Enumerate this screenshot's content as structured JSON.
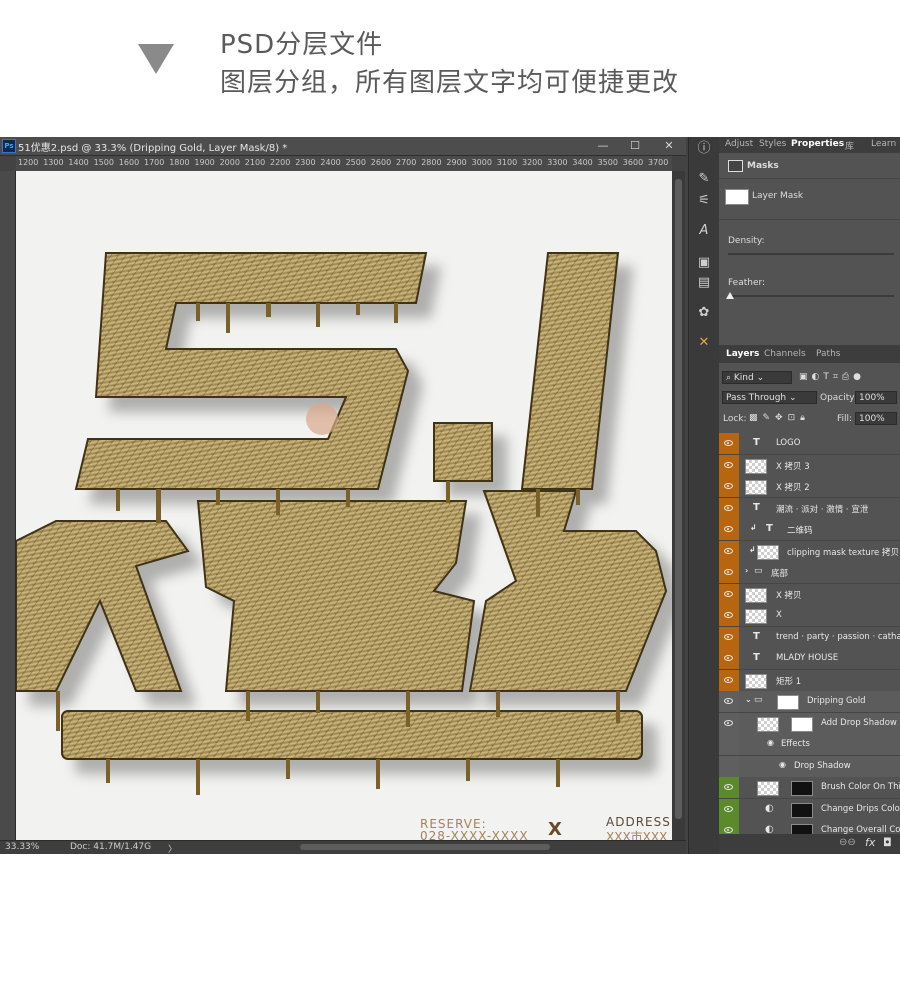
{
  "header": {
    "line1": "PSD分层文件",
    "line2": "图层分组，所有图层文字均可便捷更改"
  },
  "document": {
    "title": "51优惠2.psd @ 33.3% (Dripping Gold, Layer Mask/8) *",
    "ps_badge": "Ps",
    "window_controls": [
      "—",
      "☐",
      "✕"
    ],
    "ruler_marks": [
      "1200",
      "1300",
      "1400",
      "1500",
      "1600",
      "1700",
      "1800",
      "1900",
      "2000",
      "2100",
      "2200",
      "2300",
      "2400",
      "2500",
      "2600",
      "2700",
      "2800",
      "2900",
      "3000",
      "3100",
      "3200",
      "3300",
      "3400",
      "3500",
      "3600",
      "3700"
    ],
    "canvas": {
      "reserve_label": "RESERVE:",
      "reserve_value": "028-XXXX-XXXX",
      "x_mark": "X",
      "address_label": "ADDRESS",
      "address_value": "XXX市XXX"
    },
    "status": {
      "zoom": "33.33%",
      "doc": "Doc: 41.7M/1.47G",
      "arrow": "〉"
    }
  },
  "panel": {
    "top_tabs": [
      "Adjust",
      "Styles",
      "Properties",
      "库",
      "Learn"
    ],
    "masks_title": "Masks",
    "layer_mask_label": "Layer Mask",
    "density_label": "Density:",
    "feather_label": "Feather:",
    "layer_tabs": [
      "Layers",
      "Channels",
      "Paths"
    ],
    "kind_label": "Kind",
    "blend_mode": "Pass Through",
    "opacity_label": "Opacity:",
    "opacity_value": "100%",
    "lock_label": "Lock:",
    "fill_label": "Fill:",
    "fill_value": "100%"
  },
  "layers": [
    {
      "name": "LOGO",
      "kind": "text",
      "color": "#b8650f"
    },
    {
      "name": "X 拷贝 3",
      "kind": "pixel",
      "color": "#b8650f"
    },
    {
      "name": "X 拷贝 2",
      "kind": "pixel",
      "color": "#b8650f"
    },
    {
      "name": "潮流 · 派对 · 激情 · 宣泄",
      "kind": "text",
      "color": "#b8650f"
    },
    {
      "name": "二维码",
      "kind": "text-clip",
      "color": "#b8650f"
    },
    {
      "name": "clipping mask texture 拷贝",
      "kind": "pixel-clip",
      "color": "#b8650f"
    },
    {
      "name": "底部",
      "kind": "group",
      "color": "#b8650f"
    },
    {
      "name": "X 拷贝",
      "kind": "pixel",
      "color": "#b8650f"
    },
    {
      "name": "X",
      "kind": "pixel",
      "color": "#b8650f"
    },
    {
      "name": "trend · party · passion · catharsis",
      "kind": "text",
      "color": "#b8650f"
    },
    {
      "name": "MLADY HOUSE",
      "kind": "text",
      "color": "#b8650f"
    },
    {
      "name": "矩形 1",
      "kind": "pixel",
      "color": "#b8650f"
    },
    {
      "name": "Dripping Gold",
      "kind": "group-open",
      "color": "#5f5f5f"
    },
    {
      "name": "Add Drop Shadow",
      "kind": "mask",
      "color": "#5f5f5f"
    },
    {
      "name": "Effects",
      "kind": "effects",
      "color": "#5f5f5f"
    },
    {
      "name": "Drop Shadow",
      "kind": "effect",
      "color": "#5f5f5f"
    },
    {
      "name": "Brush Color On This",
      "kind": "mask",
      "color": "#5a8a2c"
    },
    {
      "name": "Change Drips Color",
      "kind": "adj",
      "color": "#5a8a2c"
    },
    {
      "name": "Change Overall Colo",
      "kind": "adj",
      "color": "#5a8a2c"
    },
    {
      "name": "",
      "kind": "mask",
      "color": "#a83232"
    }
  ]
}
